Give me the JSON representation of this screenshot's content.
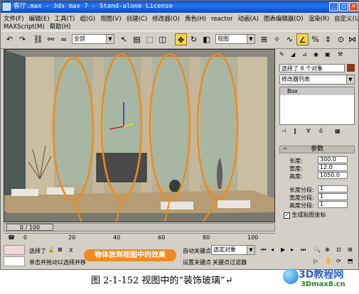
{
  "window": {
    "title": "客厅.max - 3ds max 7 - Stand-alone License"
  },
  "menu": {
    "row1": [
      "文件(F)",
      "编辑(E)",
      "工具(T)",
      "组(G)",
      "视图(V)",
      "创建(C)",
      "修改器(O)",
      "角色(H)",
      "reactor",
      "动画(A)",
      "图表编辑器(D)",
      "渲染(R)",
      "自定义(U)"
    ],
    "row2": [
      "MAXScript(M)",
      "帮助(H)"
    ]
  },
  "toolbar": {
    "selection_filter": "全部",
    "ref_coord": "视图"
  },
  "viewport": {
    "frame_label": "0 / 100",
    "annotation": "物体放到视图中的效果"
  },
  "command_panel": {
    "selection_info": "选择了 8 个对象",
    "modifier_list": "修改器列表",
    "stack_item": "Box",
    "rollout_title": "参数",
    "params": [
      {
        "label": "长度:",
        "value": "300.0"
      },
      {
        "label": "宽度:",
        "value": "12.0"
      },
      {
        "label": "高度:",
        "value": "1050.0"
      }
    ],
    "segments": [
      {
        "label": "长度分段:",
        "value": "1"
      },
      {
        "label": "宽度分段:",
        "value": "1"
      },
      {
        "label": "高度分段:",
        "value": "1"
      }
    ],
    "gen_mapping": "生成贴图坐标"
  },
  "timeline": {
    "ticks": [
      "0",
      "20",
      "40",
      "60",
      "80",
      "100"
    ]
  },
  "status": {
    "selected": "选择了",
    "hint": "单击并拖动以选择并移",
    "x_label": "X",
    "auto_key": "自动关键点",
    "set_key": "设置关键点",
    "key_filter": "关键点过滤器",
    "sel_obj": "选定对象"
  },
  "caption": "图 2-1-152   视图中的“装饰玻璃”↵",
  "logo": {
    "line1": "3D教程网",
    "line2": "3Dmax8.cn"
  },
  "colors": {
    "title_bar": "#0a4fd8",
    "annotation": "#f08a1c",
    "active_tool": "#f6d34a"
  }
}
